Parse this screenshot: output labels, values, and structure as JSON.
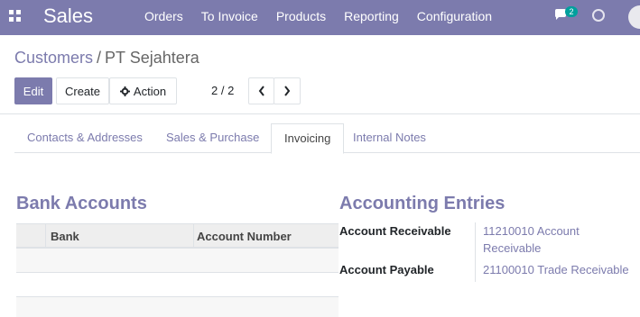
{
  "navbar": {
    "app_name": "Sales",
    "menu": [
      "Orders",
      "To Invoice",
      "Products",
      "Reporting",
      "Configuration"
    ],
    "chat_count": "2",
    "icons": [
      "apps-grid-icon",
      "chat-icon",
      "clock-icon",
      "avatar"
    ],
    "color": "#7c7bad"
  },
  "breadcrumb": {
    "parent": "Customers",
    "separator": "/",
    "current": "PT Sejahtera"
  },
  "toolbar": {
    "edit_label": "Edit",
    "create_label": "Create",
    "action_label": "Action",
    "pager": "2 / 2"
  },
  "tabs": [
    {
      "label": "Contacts & Addresses"
    },
    {
      "label": "Sales & Purchase"
    },
    {
      "label": "Invoicing",
      "active": true
    },
    {
      "label": "Internal Notes"
    }
  ],
  "bank_accounts": {
    "title": "Bank Accounts",
    "columns": [
      "Bank",
      "Account Number"
    ]
  },
  "accounting": {
    "title": "Accounting Entries",
    "receivable_label": "Account Receivable",
    "receivable_value_line1": "11210010 Account",
    "receivable_value_line2": "Receivable",
    "payable_label": "Account Payable",
    "payable_value": "21100010 Trade Receivable"
  }
}
